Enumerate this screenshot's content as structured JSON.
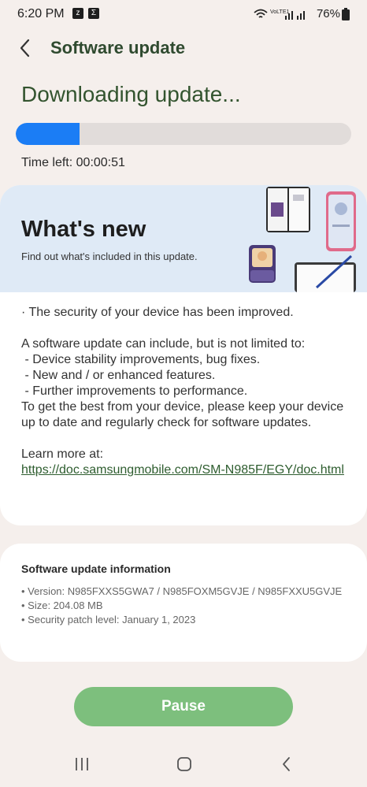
{
  "status_bar": {
    "time": "6:20 PM",
    "notif_icons": [
      "z-icon",
      "sigma-icon"
    ],
    "network_label": "VoLTE1",
    "battery": "76%"
  },
  "header": {
    "title": "Software update",
    "back_icon": "chevron-left-icon"
  },
  "download": {
    "title": "Downloading update...",
    "progress": 0.19,
    "progress_color": "#1b7df5",
    "time_left": "Time left: 00:00:51"
  },
  "whats_new": {
    "title": "What's new",
    "subtitle": "Find out what's included in this update.",
    "security_line": "· The security of your device has been improved.",
    "intro": "A software update can include, but is not limited to:",
    "bullets": [
      " - Device stability improvements, bug fixes.",
      " - New and / or enhanced features.",
      " - Further improvements to performance."
    ],
    "advice": "To get the best from your device, please keep your device up to date and regularly check for software updates.",
    "learn_more": "Learn more at:",
    "link": "https://doc.samsungmobile.com/SM-N985F/EGY/doc.html"
  },
  "info": {
    "title": "Software update information",
    "version": "• Version: N985FXXS5GWA7 / N985FOXM5GVJE / N985FXXU5GVJE",
    "size": "• Size: 204.08 MB",
    "patch": "• Security patch level: January 1, 2023"
  },
  "actions": {
    "pause_label": "Pause",
    "pause_color": "#7dbf7d"
  },
  "nav": {
    "icons": [
      "recent-apps-icon",
      "home-icon",
      "back-icon"
    ]
  }
}
